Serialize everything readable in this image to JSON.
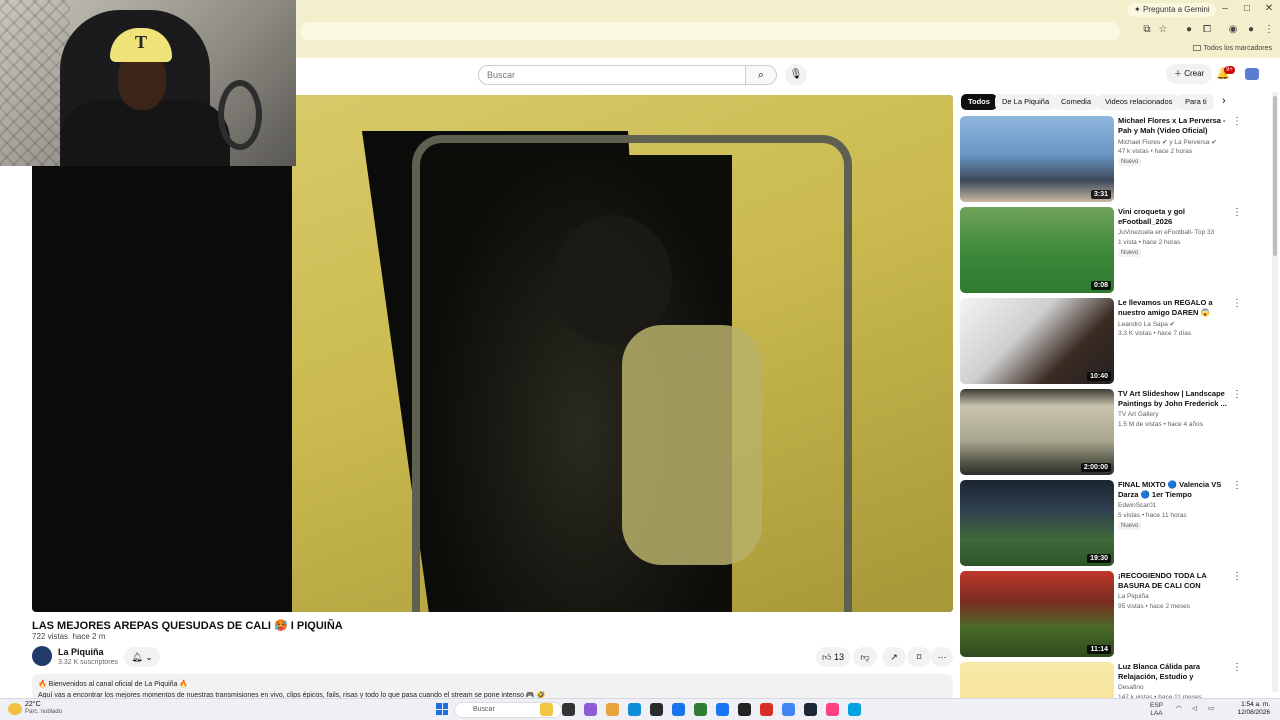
{
  "browser": {
    "gemini_label": "Pregunta a Gemini",
    "bookmarks_label": "Todos los marcadores",
    "window_controls": [
      "–",
      "□",
      "✕"
    ]
  },
  "masthead": {
    "search_placeholder": "Buscar",
    "create_label": "Crear",
    "notifications_badge": "9+"
  },
  "video": {
    "title": "LAS MEJORES AREPAS QUESUDAS DE CALI 🥵 I PIQUIÑA",
    "views": "722 vistas",
    "age": "hace 2 m",
    "channel": "La Piquiña",
    "subscribers": "3.32 K suscriptores",
    "likes": "13",
    "description_line1": "🔥 Bienvenidos al canal oficial de La Piquiña 🔥",
    "description_line2": "Aquí vas a encontrar los mejores momentos de nuestras transmisiones en vivo, clips épicos, fails, risas y todo lo que pasa cuando el stream se pone intenso 🎮 🤣"
  },
  "webcam": {
    "cap_logo": "T"
  },
  "chips": [
    {
      "label": "Todos",
      "active": true
    },
    {
      "label": "De La Piquiña",
      "active": false
    },
    {
      "label": "Comedia",
      "active": false
    },
    {
      "label": "Videos relacionados",
      "active": false
    },
    {
      "label": "Para ti",
      "active": false
    }
  ],
  "recommended": [
    {
      "title": "Michael Flores x La Perversa - Pah y Mah (Video Oficial)",
      "channel": "Michael Flores ✔ y La Perversa ✔",
      "stats": "47 k vistas • hace 2 horas",
      "badge": "Nuevo",
      "duration": "3:31",
      "thumb": "linear-gradient(180deg,#8fb6dc 0%,#6a95c4 45%,#3d4a5a 75%,#c9b8a5 100%)"
    },
    {
      "title": "Vini croqueta y gol eFootball_2026",
      "channel": "JuVinezuela en eFootball- Top 33",
      "stats": "1 vista • hace 2 horas",
      "badge": "Nuevo",
      "duration": "0:08",
      "thumb": "linear-gradient(180deg,#6fa35a 0%,#3f8a3b 50%,#2e7a2f 100%)"
    },
    {
      "title": "Le llevamos un REGALO a nuestro amigo DAREN 😱",
      "channel": "Leandro La Sapa ✔",
      "stats": "3.3 K vistas • hace 7 días",
      "badge": "",
      "duration": "10:40",
      "thumb": "linear-gradient(135deg,#f4f4f4 0%,#cfcfcf 40%,#3a2a22 70%,#222 100%)"
    },
    {
      "title": "TV Art Slideshow | Landscape Paintings by John Frederick ...",
      "channel": "TV Art Gallery",
      "stats": "1.5 M de vistas • hace 4 años",
      "badge": "",
      "duration": "2:00:00",
      "thumb": "linear-gradient(180deg,#3b3b35 0%,#c9c4ae 20%,#a9a68f 60%,#55584a 85%,#2c2c28 100%)"
    },
    {
      "title": "FINAL MIXTO 🔵 Valencia VS Darza 🔵 1er Tiempo",
      "channel": "EdwinScar01",
      "stats": "5 vistas • hace 11 horas",
      "badge": "Nuevo",
      "duration": "19:30",
      "thumb": "linear-gradient(180deg,#1a2430 0%,#2f3f4f 35%,#3f6a3a 70%,#2d5428 100%)"
    },
    {
      "title": "¡RECOGIENDO TODA LA BASURA DE CALI CON ISMAEL SANCHEZ! ...",
      "channel": "La Piquiña",
      "stats": "95 vistas • hace 2 meses",
      "badge": "",
      "duration": "11:14",
      "thumb": "linear-gradient(180deg,#c0392b 0%,#7a2a20 35%,#4d6b2a 65%,#2e4a1e 100%)"
    },
    {
      "title": "Luz Blanca Cálida para Relajación, Estudio y Concentración – ...",
      "channel": "Desafino",
      "stats": "147 k vistas • hace 11 meses",
      "badge": "",
      "duration": "",
      "thumb": "linear-gradient(180deg,#f7e9a8 0%,#f3df8f 100%)"
    }
  ],
  "taskbar": {
    "temperature": "22°C",
    "weather": "Parc. nublado",
    "search_label": "Buscar",
    "language": "ESP",
    "language_sub": "LAA",
    "time": "1:54 a. m.",
    "date": "12/08/2026",
    "apps": [
      "#f4c542",
      "#333333",
      "#8e5bd6",
      "#e8a33a",
      "#0c8fd6",
      "#2b2b2b",
      "#1a73e8",
      "#2e7d32",
      "#1877f2",
      "#222222",
      "#d93025",
      "#4285f4",
      "#1b2838",
      "#ff4081",
      "#00a3e0"
    ]
  }
}
